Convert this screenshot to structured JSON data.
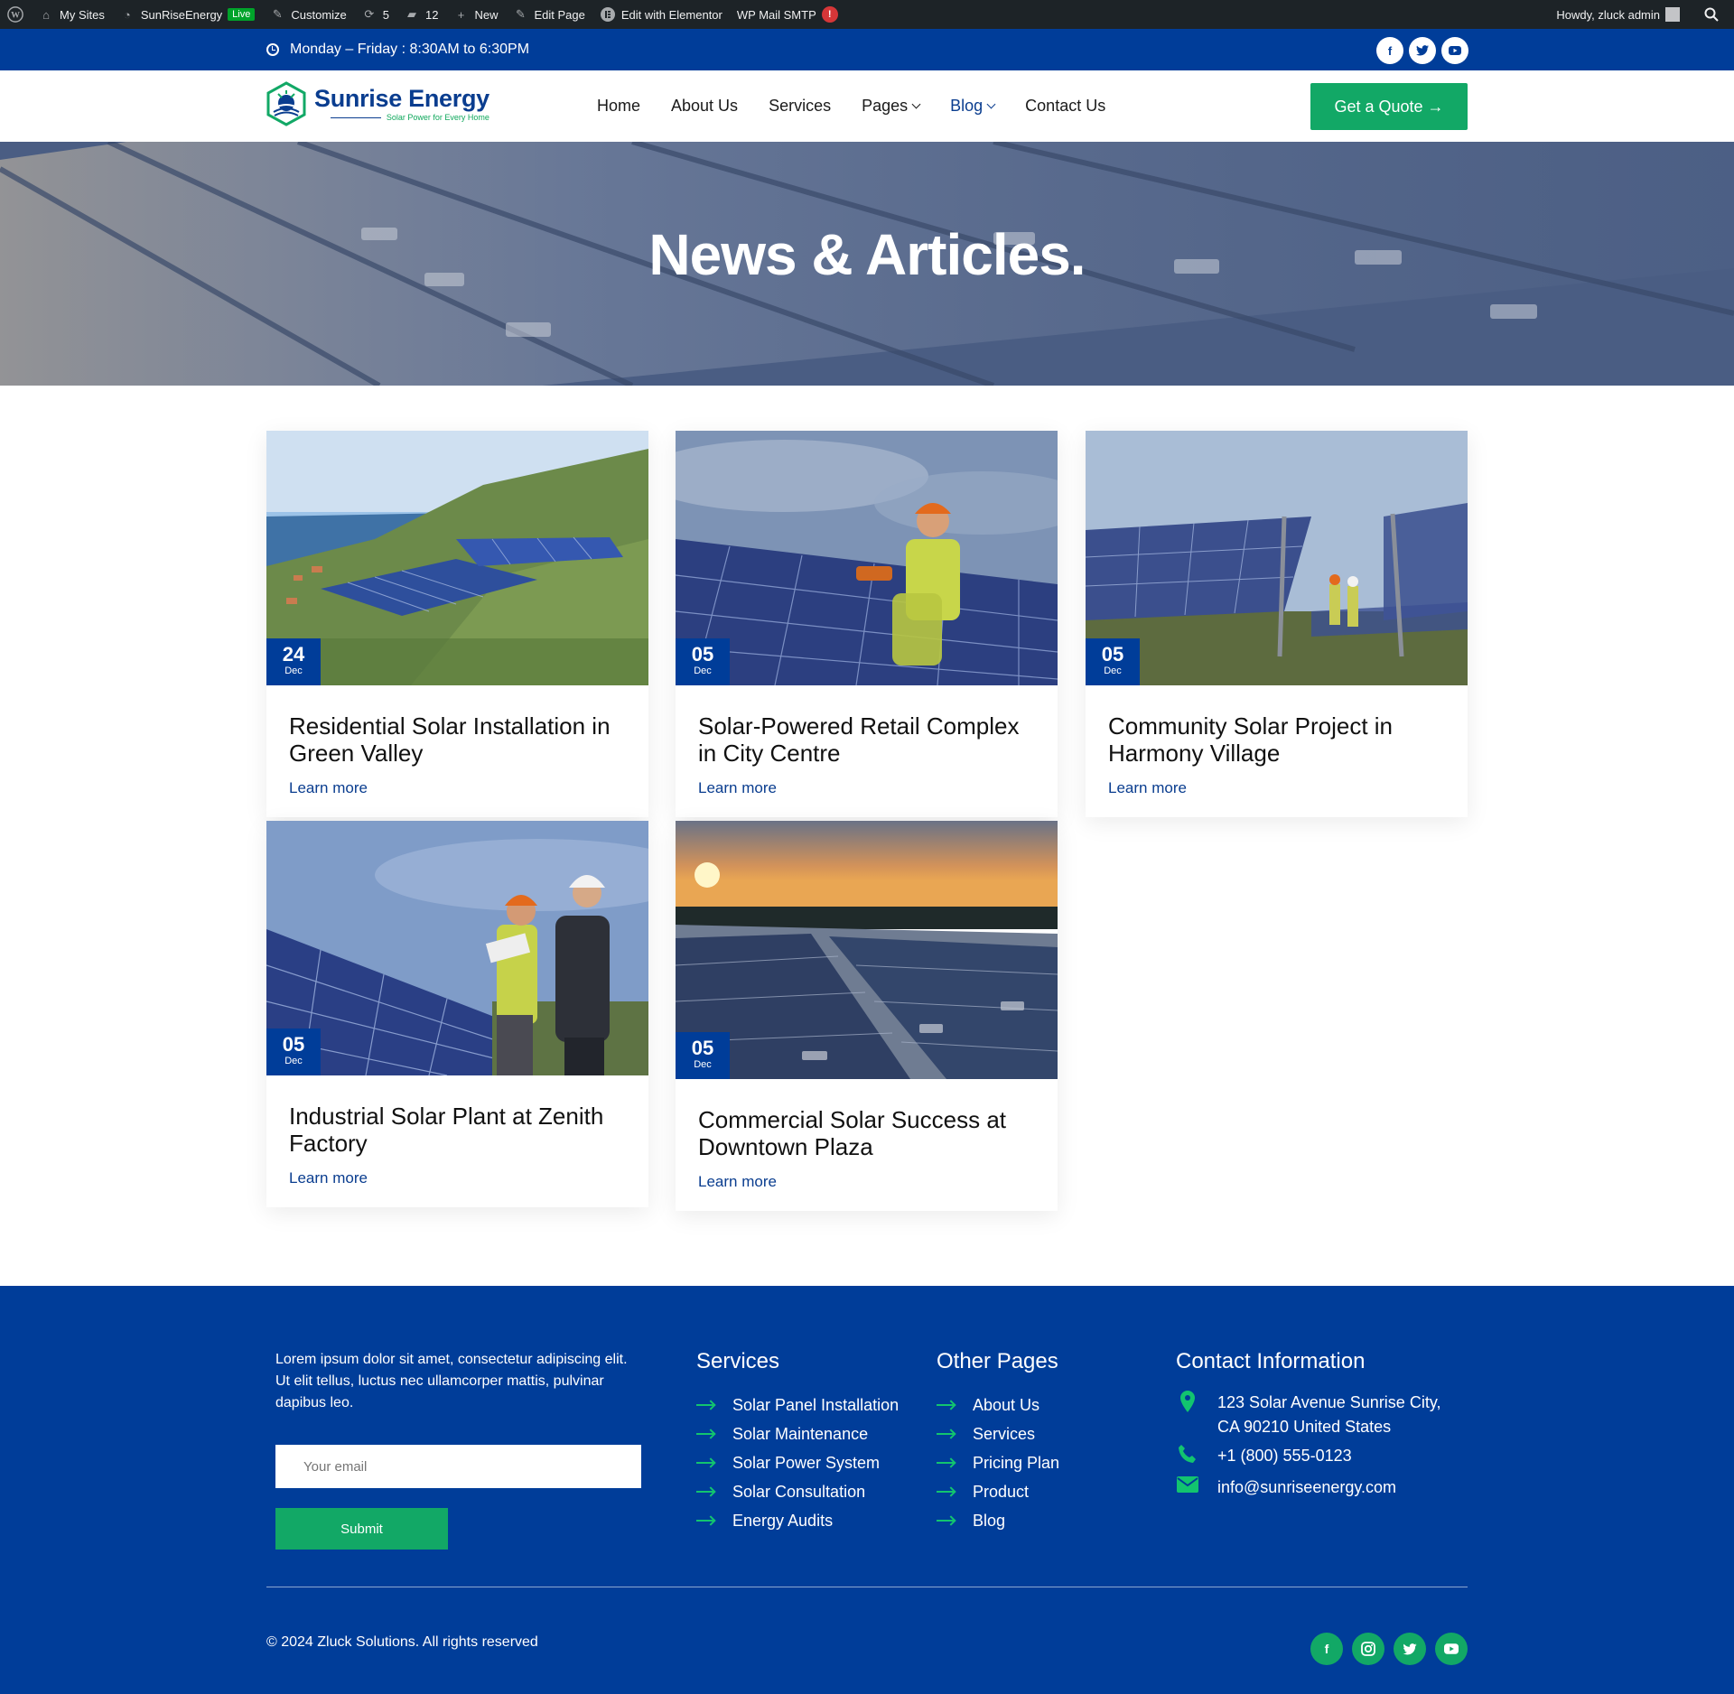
{
  "admin_bar": {
    "items": [
      {
        "label": "My Sites",
        "icon": "house-icon"
      },
      {
        "label": "SunRiseEnergy",
        "icon": "dashboard-icon"
      },
      {
        "label": "Customize",
        "icon": "brush-icon"
      },
      {
        "label": "5",
        "icon": "refresh-icon"
      },
      {
        "label": "12",
        "icon": "comment-icon"
      },
      {
        "label": "New",
        "icon": "plus-icon"
      },
      {
        "label": "Edit Page",
        "icon": "pencil-icon"
      },
      {
        "label": "Edit with Elementor",
        "icon": "elementor-icon"
      },
      {
        "label": "WP Mail SMTP",
        "icon": "mail-icon"
      }
    ],
    "live_badge": "Live",
    "smtp_alert": "!",
    "greeting": "Howdy, zluck admin"
  },
  "topbar": {
    "hours": "Monday – Friday : 8:30AM to 6:30PM",
    "socials": [
      "facebook-icon",
      "twitter-icon",
      "youtube-icon"
    ]
  },
  "header": {
    "logo": {
      "name": "Sunrise Energy",
      "tagline": "Solar Power for Every Home"
    },
    "nav": [
      {
        "label": "Home",
        "dropdown": false,
        "active": false
      },
      {
        "label": "About Us",
        "dropdown": false,
        "active": false
      },
      {
        "label": "Services",
        "dropdown": false,
        "active": false
      },
      {
        "label": "Pages",
        "dropdown": true,
        "active": false
      },
      {
        "label": "Blog",
        "dropdown": true,
        "active": true
      },
      {
        "label": "Contact Us",
        "dropdown": false,
        "active": false
      }
    ],
    "cta": "Get a Quote →"
  },
  "hero": {
    "title": "News & Articles."
  },
  "posts": [
    {
      "day": "24",
      "month": "Dec",
      "title": "Residential Solar Installation in Green Valley",
      "link": "Learn more"
    },
    {
      "day": "05",
      "month": "Dec",
      "title": "Solar-Powered Retail Complex in City Centre",
      "link": "Learn more"
    },
    {
      "day": "05",
      "month": "Dec",
      "title": "Community Solar Project in Harmony Village",
      "link": "Learn more"
    },
    {
      "day": "05",
      "month": "Dec",
      "title": "Industrial Solar Plant at Zenith Factory",
      "link": "Learn more"
    },
    {
      "day": "05",
      "month": "Dec",
      "title": "Commercial Solar Success at Downtown Plaza",
      "link": "Learn more"
    }
  ],
  "footer": {
    "about": "Lorem ipsum dolor sit amet, consectetur adipiscing elit. Ut elit tellus, luctus nec ullamcorper mattis, pulvinar dapibus leo.",
    "email_placeholder": "Your email",
    "submit": "Submit",
    "services": {
      "title": "Services",
      "items": [
        "Solar Panel Installation",
        "Solar Maintenance",
        "Solar Power System",
        "Solar Consultation",
        "Energy Audits"
      ]
    },
    "other_pages": {
      "title": "Other Pages",
      "items": [
        "About Us",
        "Services",
        "Pricing Plan",
        "Product",
        "Blog"
      ]
    },
    "contact": {
      "title": "Contact Information",
      "address_line1": "123 Solar Avenue Sunrise City,",
      "address_line2": "CA 90210 United States",
      "phone": "+1 (800) 555-0123",
      "email": "info@sunriseenergy.com"
    },
    "copyright": "© 2024 Zluck Solutions. All rights reserved",
    "socials": [
      "facebook-icon",
      "instagram-icon",
      "twitter-icon",
      "youtube-icon"
    ]
  },
  "colors": {
    "primary_blue": "#003d99",
    "accent_green": "#12a866",
    "admin_bar": "#1d2327"
  }
}
